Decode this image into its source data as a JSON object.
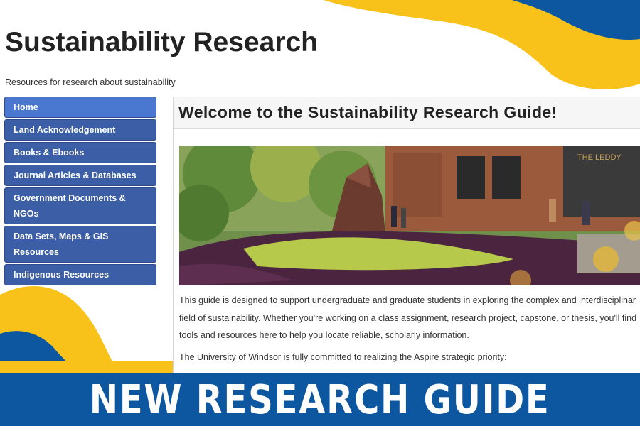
{
  "header": {
    "title": "Sustainability Research",
    "subtitle": "Resources for research about sustainability."
  },
  "sidebar": {
    "items": [
      {
        "label": "Home",
        "active": true
      },
      {
        "label": "Land Acknowledgement"
      },
      {
        "label": "Books & Ebooks"
      },
      {
        "label": "Journal Articles & Databases"
      },
      {
        "label": "Government Documents & NGOs"
      },
      {
        "label": "Data Sets, Maps & GIS Resources"
      },
      {
        "label": "Indigenous Resources"
      }
    ]
  },
  "main": {
    "title": "Welcome to the Sustainability Research Guide!",
    "photo_sign": "THE LEDDY",
    "paragraphs": [
      "This guide is designed to support undergraduate and graduate students in exploring the complex and interdisciplinar",
      "field of sustainability. Whether you're working on a class assignment, research project, capstone, or thesis, you'll find",
      "tools and resources here to help you locate reliable, scholarly information.",
      "The University of Windsor is fully committed to realizing the Aspire strategic priority:"
    ]
  },
  "banner": {
    "text": "NEW RESEARCH GUIDE"
  },
  "colors": {
    "yellow": "#f8c21a",
    "blue": "#0d57a0",
    "nav_blue": "#3b5ea6",
    "nav_active": "#4a77cf"
  }
}
